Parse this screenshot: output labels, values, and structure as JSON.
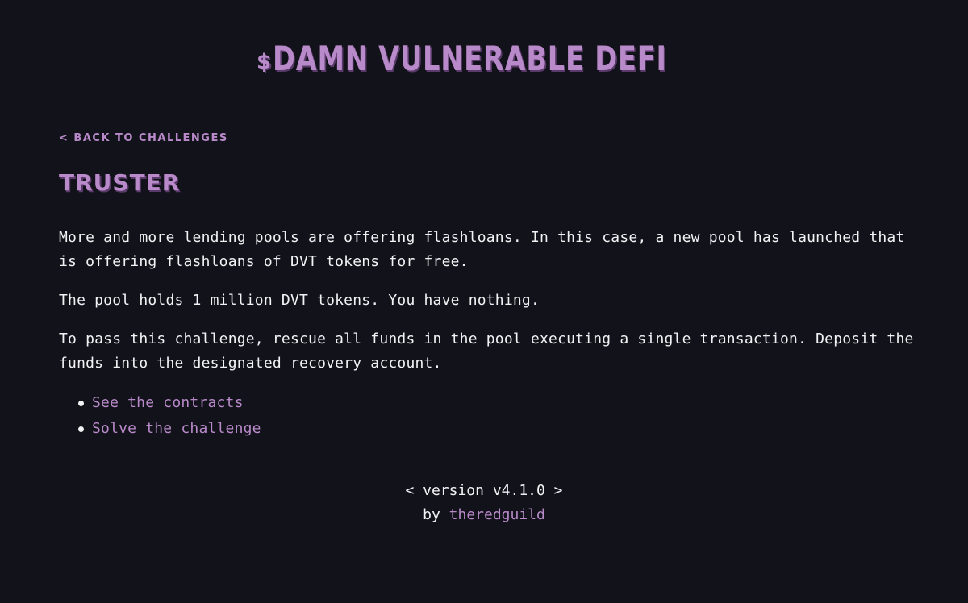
{
  "header": {
    "logo_symbol": "$",
    "logo_text": "DAMN VULNERABLE DEFI"
  },
  "nav": {
    "back_label": "< BACK TO CHALLENGES"
  },
  "challenge": {
    "title": "TRUSTER",
    "paragraphs": [
      "More and more lending pools are offering flashloans. In this case, a new pool has launched that is offering flashloans of DVT tokens for free.",
      "The pool holds 1 million DVT tokens. You have nothing.",
      "To pass this challenge, rescue all funds in the pool executing a single transaction. Deposit the funds into the designated recovery account."
    ],
    "links": [
      {
        "label": "See the contracts"
      },
      {
        "label": "Solve the challenge"
      }
    ]
  },
  "footer": {
    "version": "< version v4.1.0 >",
    "by_text": "by",
    "author": "theredguild"
  },
  "colors": {
    "background": "#12121a",
    "accent": "#b88ac9",
    "text": "#f2f2f5"
  }
}
